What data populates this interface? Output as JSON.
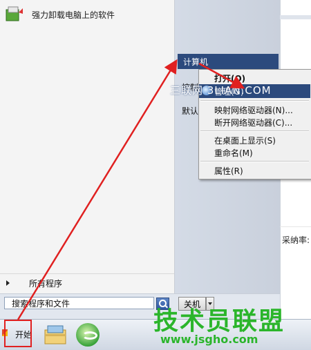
{
  "start_menu": {
    "pinned_program": "强力卸载电脑上的软件",
    "all_programs": "所有程序",
    "search": {
      "value": "搜索程序和文件",
      "placeholder": "搜索程序和文件"
    },
    "shutdown_label": "关机",
    "right_pane": {
      "computer": "计算机",
      "control_panel_partial": "控制",
      "default_programs_partial": "默认"
    }
  },
  "context_menu": {
    "items": [
      {
        "label": "打开(O)",
        "bold": true
      },
      {
        "label": "管理(G)",
        "highlighted": true
      },
      {
        "label": "映射网络驱动器(N)..."
      },
      {
        "label": "断开网络驱动器(C)..."
      },
      {
        "label": "在桌面上显示(S)"
      },
      {
        "label": "重命名(M)"
      },
      {
        "label": "属性(R)"
      }
    ]
  },
  "background": {
    "partial_label": "采纳率:"
  },
  "taskbar": {
    "start_label": "开始"
  },
  "watermarks": {
    "overlay_text": "三联网 3LIAN.COM",
    "logo_text": "技术员联盟",
    "logo_url": "www.jsgho.com"
  },
  "colors": {
    "highlight": "#2c4a7d",
    "annotation": "#e02020",
    "watermark_green": "#2bb52b"
  },
  "icons": [
    "uninstall-app-icon",
    "search-icon",
    "shutdown-arrow-icon",
    "manage-icon",
    "windows-flag-icon",
    "file-explorer-icon",
    "browser-icon",
    "expand-arrow-icon"
  ]
}
